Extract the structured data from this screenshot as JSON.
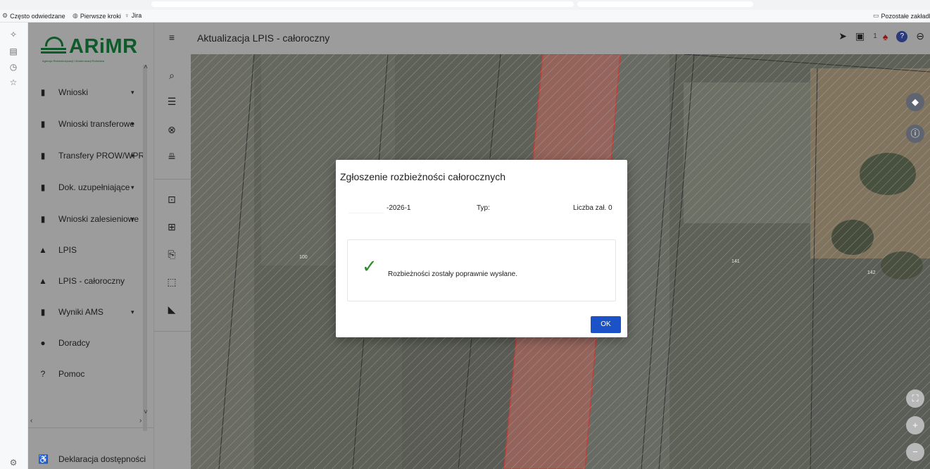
{
  "browser": {
    "bookmarks": [
      {
        "label": "Często odwiedzane",
        "icon": "gear-icon"
      },
      {
        "label": "Pierwsze kroki",
        "icon": "globe-icon"
      },
      {
        "label": "Jira",
        "icon": "jira-icon"
      }
    ],
    "other_bookmarks": "Pozostałe zakładki"
  },
  "logo": {
    "name": "ARiMR",
    "subtitle": "Agencja Restrukturyzacji i Modernizacji Rolnictwa"
  },
  "nav": {
    "items": [
      {
        "label": "Wnioski",
        "icon": "clipboard-icon",
        "has_chevron": true
      },
      {
        "label": "Wnioski transferowe",
        "icon": "clipboard-icon",
        "has_chevron": true
      },
      {
        "label": "Transfery PROW/WPR",
        "icon": "clipboard-icon",
        "has_chevron": true
      },
      {
        "label": "Dok. uzupełniające",
        "icon": "clipboard-icon",
        "has_chevron": true
      },
      {
        "label": "Wnioski zalesieniowe",
        "icon": "clipboard-icon",
        "has_chevron": true
      },
      {
        "label": "LPIS",
        "icon": "mountain-icon",
        "has_chevron": false
      },
      {
        "label": "LPIS - całoroczny",
        "icon": "mountain-icon",
        "has_chevron": false
      },
      {
        "label": "Wyniki AMS",
        "icon": "clipboard-icon",
        "has_chevron": true
      },
      {
        "label": "Doradcy",
        "icon": "person-icon",
        "has_chevron": false
      },
      {
        "label": "Pomoc",
        "icon": "help-icon",
        "has_chevron": false
      }
    ],
    "footer_item": {
      "label": "Deklaracja dostępności",
      "icon": "accessibility-icon"
    }
  },
  "header": {
    "title": "Aktualizacja LPIS - całoroczny",
    "notification_count": "1"
  },
  "map": {
    "parcel_labels": [
      "100",
      "141",
      "142"
    ]
  },
  "modal": {
    "title": "Zgłoszenie rozbieżności całorocznych",
    "doc_number": "-2026-1",
    "type_label": "Typ:",
    "attachments_label": "Liczba zał. 0",
    "message": "Rozbieżności zostały poprawnie wysłane.",
    "ok_label": "OK"
  },
  "colors": {
    "brand_green": "#0f5a2a",
    "primary_button": "#1b52c7",
    "success_check": "#2e8b2e",
    "selected_parcel": "#c0392b"
  }
}
